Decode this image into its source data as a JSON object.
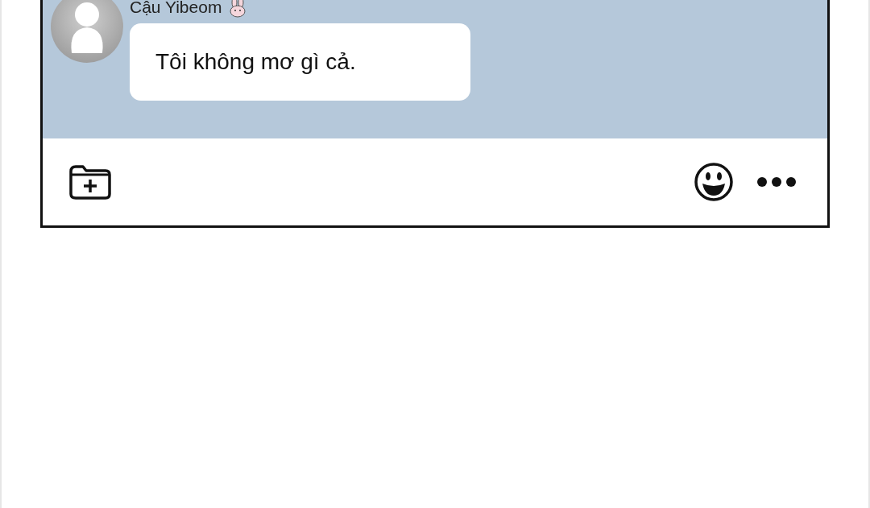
{
  "message": {
    "sender": "Cậu Yibeom",
    "text": "Tôi không mơ gì cả."
  }
}
